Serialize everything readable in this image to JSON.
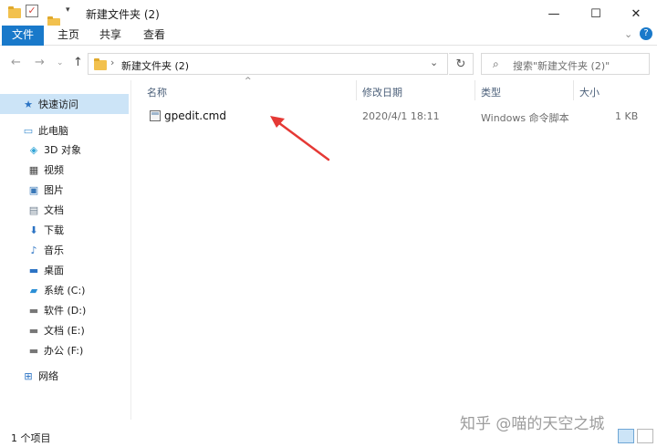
{
  "window": {
    "title": "新建文件夹 (2)",
    "controls": {
      "minimize": "—",
      "maximize": "☐",
      "close": "✕"
    }
  },
  "ribbon": {
    "tabs": [
      {
        "label": "文件",
        "active": true
      },
      {
        "label": "主页",
        "active": false
      },
      {
        "label": "共享",
        "active": false
      },
      {
        "label": "查看",
        "active": false
      }
    ],
    "expand_icon": "chevron-down",
    "help_icon": "?"
  },
  "address": {
    "path": "新建文件夹 (2)",
    "search_placeholder": "搜索\"新建文件夹 (2)\""
  },
  "sidebar": {
    "quick_access": "快速访问",
    "this_pc": "此电脑",
    "items": [
      {
        "label": "3D 对象",
        "icon": "3d-objects-icon"
      },
      {
        "label": "视频",
        "icon": "video-icon"
      },
      {
        "label": "图片",
        "icon": "pictures-icon"
      },
      {
        "label": "文档",
        "icon": "documents-icon"
      },
      {
        "label": "下载",
        "icon": "download-icon"
      },
      {
        "label": "音乐",
        "icon": "music-icon"
      },
      {
        "label": "桌面",
        "icon": "desktop-icon"
      },
      {
        "label": "系统 (C:)",
        "icon": "system-drive-icon"
      },
      {
        "label": "软件 (D:)",
        "icon": "drive-icon"
      },
      {
        "label": "文档 (E:)",
        "icon": "drive-icon"
      },
      {
        "label": "办公 (F:)",
        "icon": "drive-icon"
      }
    ],
    "network": "网络"
  },
  "columns": {
    "name": "名称",
    "modified": "修改日期",
    "type": "类型",
    "size": "大小"
  },
  "files": [
    {
      "name": "gpedit.cmd",
      "modified": "2020/4/1 18:11",
      "type": "Windows 命令脚本",
      "size": "1 KB"
    }
  ],
  "status": {
    "count": "1 个项目"
  },
  "watermark": "知乎 @喵的天空之城",
  "colors": {
    "accent": "#1979ca",
    "selection": "#cce4f7",
    "folder": "#f2c14e",
    "annotation_arrow": "#e53935"
  }
}
